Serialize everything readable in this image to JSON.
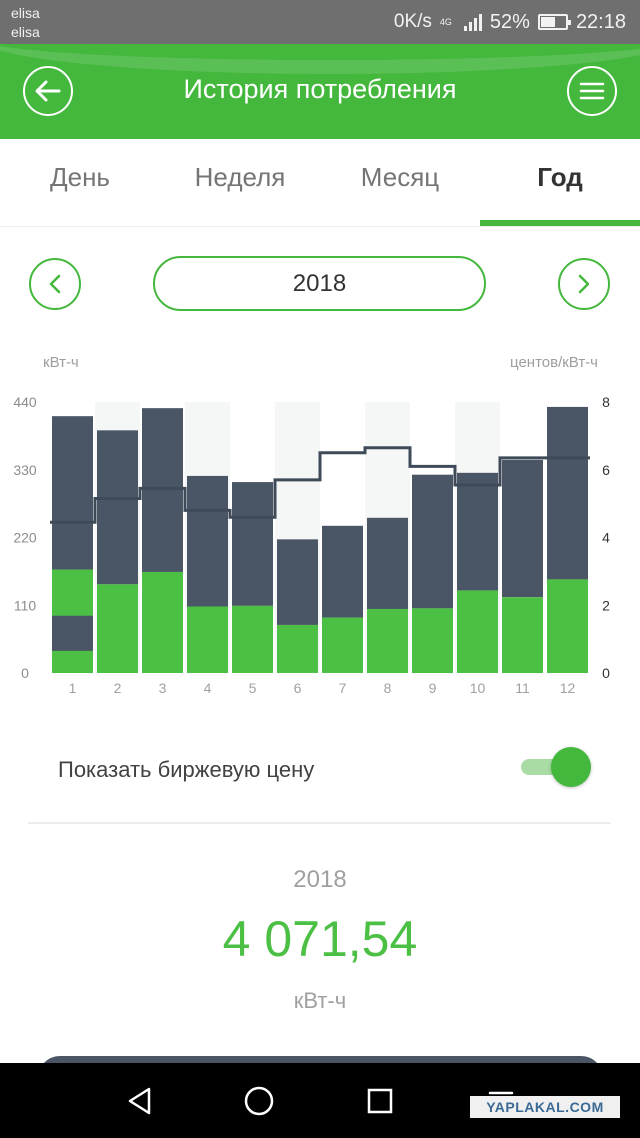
{
  "status_bar": {
    "carrier_line1": "elisa",
    "carrier_line2": "elisa",
    "network_speed": "0K/s",
    "network_type": "4G",
    "battery_percent": "52%",
    "battery_level": 0.52,
    "time": "22:18"
  },
  "header": {
    "title": "История потребления",
    "back_icon": "arrow-left-icon",
    "menu_icon": "hamburger-menu-icon",
    "background_color": "#44b73d"
  },
  "tabs": [
    {
      "label": "День",
      "active": false
    },
    {
      "label": "Неделя",
      "active": false
    },
    {
      "label": "Месяц",
      "active": false
    },
    {
      "label": "Год",
      "active": true
    }
  ],
  "period": {
    "value": "2018",
    "prev_icon": "chevron-left-icon",
    "next_icon": "chevron-right-icon"
  },
  "chart_data": {
    "type": "bar",
    "left_unit": "кВт-ч",
    "right_unit": "центов/кВт-ч",
    "categories": [
      "1",
      "2",
      "3",
      "4",
      "5",
      "6",
      "7",
      "8",
      "9",
      "10",
      "11",
      "12"
    ],
    "ylim": [
      0,
      440
    ],
    "y_ticks": [
      0,
      110,
      220,
      330,
      440
    ],
    "y2lim": [
      0,
      8
    ],
    "y2_ticks": [
      0,
      2,
      4,
      6,
      8
    ],
    "stacked": true,
    "series": [
      {
        "values": [
          168,
          144,
          164,
          108,
          109,
          78,
          90,
          104,
          105,
          134,
          123,
          152
        ],
        "color": "#4cbf45"
      },
      {
        "values": [
          249,
          250,
          266,
          212,
          201,
          139,
          149,
          148,
          217,
          191,
          223,
          280
        ],
        "color": "#4a5665"
      }
    ],
    "inner_segments_month1": [
      36,
      57,
      75
    ],
    "line": {
      "values": [
        4.45,
        5.15,
        5.45,
        4.8,
        4.6,
        5.7,
        6.5,
        6.65,
        6.1,
        5.55,
        6.35,
        6.35
      ],
      "color": "#3f4a58",
      "axis": "right"
    },
    "shaded_columns": [
      2,
      4,
      6,
      8,
      10
    ],
    "grid": false
  },
  "toggle": {
    "label": "Показать биржевую цену",
    "on": true
  },
  "summary": {
    "year": "2018",
    "value": "4 071,54",
    "unit": "кВт-ч"
  },
  "nav_bar": {
    "back_icon": "triangle-back-icon",
    "home_icon": "circle-home-icon",
    "recents_icon": "square-recents-icon",
    "more_icon": "down-menu-icon"
  },
  "watermark": "YAPLAKAL.COM"
}
